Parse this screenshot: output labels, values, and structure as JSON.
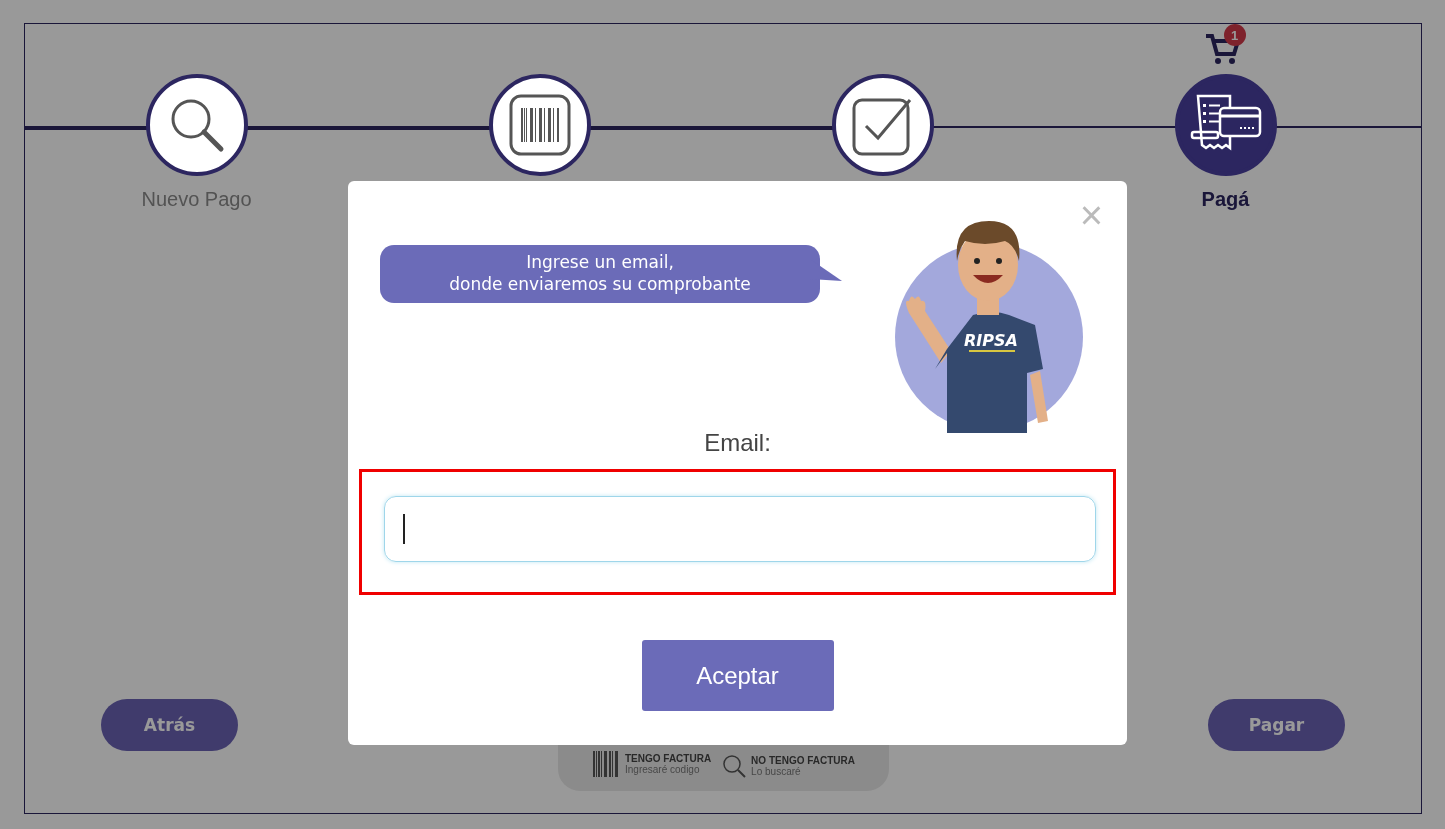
{
  "stepper": {
    "cart_badge": "1",
    "steps": [
      {
        "kind": "search",
        "label": "Nuevo Pago",
        "selected": false
      },
      {
        "kind": "barcode",
        "selected": false
      },
      {
        "kind": "check",
        "selected": false
      },
      {
        "kind": "receipt",
        "label": "Pagá",
        "selected": true
      }
    ]
  },
  "nav_buttons": [
    "Atrás",
    "Pagar"
  ],
  "invoice_options": [
    {
      "kind": "barcode",
      "title": "TENGO FACTURA",
      "subtitle": "Ingresaré codigo"
    },
    {
      "kind": "search",
      "title": "NO TENGO FACTURA",
      "subtitle": "Lo buscaré"
    }
  ],
  "dialog": {
    "close": "×",
    "speech": "Ingrese un email,\ndonde enviaremos su comprobante",
    "mascot_shirt": "RIPSA",
    "field_label": "Email:",
    "field": {
      "focused": true,
      "highlighted": true
    },
    "button": "Aceptar"
  }
}
